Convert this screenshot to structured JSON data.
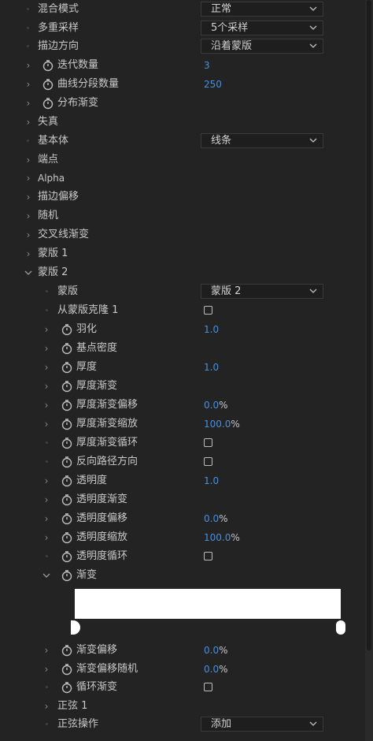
{
  "colors": {
    "background": "#232323",
    "value_blue": "#4c8ed8",
    "text": "#c9c9c9"
  },
  "rows": {
    "blend_mode": {
      "label": "混合模式",
      "value": "正常"
    },
    "multisample": {
      "label": "多重采样",
      "value": "5个采样"
    },
    "stroke_direction": {
      "label": "描边方向",
      "value": "沿着蒙版"
    },
    "iterations": {
      "label": "迭代数量",
      "value": "3"
    },
    "curve_segments": {
      "label": "曲线分段数量",
      "value": "250"
    },
    "distribute_taper": {
      "label": "分布渐变"
    },
    "distortion": {
      "label": "失真"
    },
    "primitive": {
      "label": "基本体",
      "value": "线条"
    },
    "endpoints": {
      "label": "端点"
    },
    "alpha": {
      "label": "Alpha"
    },
    "stroke_offset": {
      "label": "描边偏移"
    },
    "random": {
      "label": "随机"
    },
    "crosshatch_taper": {
      "label": "交叉线渐变"
    },
    "mask1": {
      "label": "蒙版 1"
    },
    "mask2": {
      "label": "蒙版 2"
    },
    "mask": {
      "label": "蒙版",
      "value": "蒙版 2"
    },
    "clone_from_mask": {
      "label": "从蒙版克隆 1",
      "checked": false
    },
    "feather": {
      "label": "羽化",
      "value": "1.0"
    },
    "base_density": {
      "label": "基点密度"
    },
    "thickness": {
      "label": "厚度",
      "value": "1.0"
    },
    "thickness_taper": {
      "label": "厚度渐变"
    },
    "thickness_taper_offset": {
      "label": "厚度渐变偏移",
      "value": "0.0",
      "unit": "%"
    },
    "thickness_taper_scale": {
      "label": "厚度渐变缩放",
      "value": "100.0",
      "unit": "%"
    },
    "thickness_taper_loop": {
      "label": "厚度渐变循环",
      "checked": false
    },
    "reverse_path": {
      "label": "反向路径方向",
      "checked": false
    },
    "opacity": {
      "label": "透明度",
      "value": "1.0"
    },
    "opacity_taper": {
      "label": "透明度渐变"
    },
    "opacity_offset": {
      "label": "透明度偏移",
      "value": "0.0",
      "unit": "%"
    },
    "opacity_scale": {
      "label": "透明度缩放",
      "value": "100.0",
      "unit": "%"
    },
    "opacity_loop": {
      "label": "透明度循环",
      "checked": false
    },
    "gradient": {
      "label": "渐变"
    },
    "gradient_offset": {
      "label": "渐变偏移",
      "value": "0.0",
      "unit": "%"
    },
    "gradient_offset_random": {
      "label": "渐变偏移随机",
      "value": "0.0",
      "unit": "%"
    },
    "loop_gradient": {
      "label": "循环渐变",
      "checked": false
    },
    "sine1": {
      "label": "正弦 1"
    },
    "sine_op": {
      "label": "正弦操作",
      "value": "添加"
    }
  }
}
